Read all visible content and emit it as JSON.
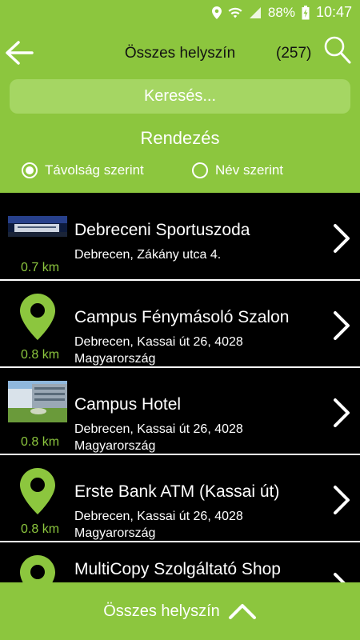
{
  "status_bar": {
    "battery": "88%",
    "time": "10:47"
  },
  "header": {
    "title": "Összes helyszín",
    "count": "(257)",
    "icons": {
      "back": "arrow-left-icon",
      "search": "search-icon"
    }
  },
  "search": {
    "placeholder": "Keresés..."
  },
  "sort": {
    "title": "Rendezés",
    "options": [
      {
        "label": "Távolság szerint",
        "selected": true
      },
      {
        "label": "Név szerint",
        "selected": false
      }
    ]
  },
  "locations": [
    {
      "name": "Debreceni Sportuszoda",
      "address": "Debrecen, Zákány utca 4.",
      "distance": "0.7 km",
      "thumb": "building-photo"
    },
    {
      "name": "Campus Fénymásoló Szalon",
      "address": "Debrecen, Kassai út 26, 4028 Magyarország",
      "distance": "0.8 km",
      "thumb": "map-pin-icon"
    },
    {
      "name": "Campus Hotel",
      "address": "Debrecen, Kassai út 26, 4028 Magyarország",
      "distance": "0.8 km",
      "thumb": "hotel-photo"
    },
    {
      "name": "Erste Bank ATM (Kassai út)",
      "address": "Debrecen, Kassai út 26, 4028 Magyarország",
      "distance": "0.8 km",
      "thumb": "map-pin-icon"
    },
    {
      "name": "MultiCopy Szolgáltató Shop",
      "address": "",
      "distance": "",
      "thumb": "map-pin-icon"
    }
  ],
  "footer": {
    "label": "Összes helyszín",
    "icon": "chevron-up-icon"
  },
  "colors": {
    "accent": "#8cc63e",
    "search_bg": "#a5d663",
    "list_bg": "#000000"
  }
}
